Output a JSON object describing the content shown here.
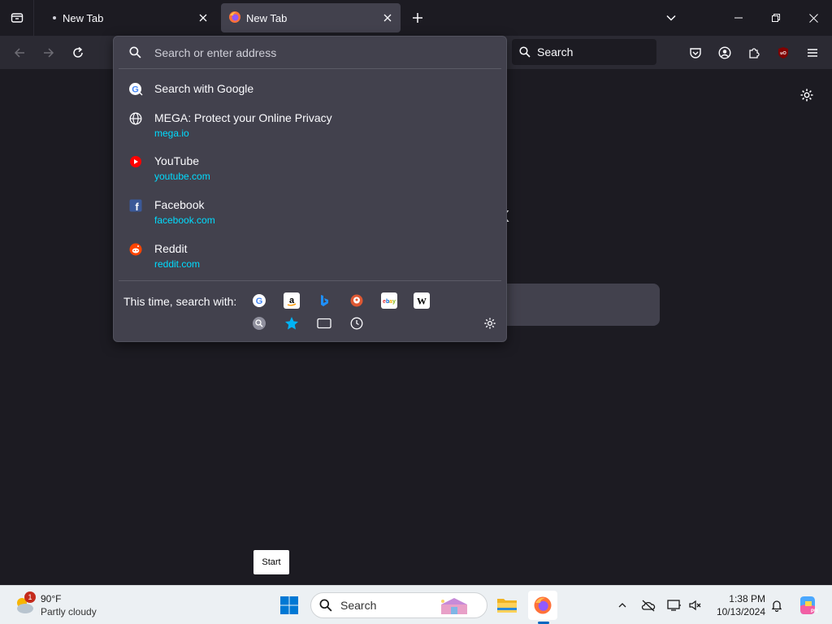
{
  "tabs": [
    {
      "label": "New Tab",
      "active": false
    },
    {
      "label": "New Tab",
      "active": true
    }
  ],
  "toolbar": {
    "search_label": "Search"
  },
  "urlbar": {
    "placeholder": "Search or enter address",
    "results": [
      {
        "title": "Search with Google",
        "url": "",
        "icon": "google-icon"
      },
      {
        "title": "MEGA: Protect your Online Privacy",
        "url": "mega.io",
        "icon": "globe-icon"
      },
      {
        "title": "YouTube",
        "url": "youtube.com",
        "icon": "youtube-icon"
      },
      {
        "title": "Facebook",
        "url": "facebook.com",
        "icon": "facebook-icon"
      },
      {
        "title": "Reddit",
        "url": "reddit.com",
        "icon": "reddit-icon"
      }
    ],
    "oneoff_label": "This time, search with:",
    "engines": [
      "google-icon",
      "amazon-icon",
      "bing-icon",
      "duckduckgo-icon",
      "ebay-icon",
      "wikipedia-icon",
      "search-history-icon",
      "bookmarks-icon",
      "tabs-icon",
      "history-icon"
    ]
  },
  "page": {
    "logo_fragment": "x"
  },
  "tooltip": {
    "text": "Start"
  },
  "taskbar": {
    "weather_temp": "90°F",
    "weather_condition": "Partly cloudy",
    "weather_badge": "1",
    "search_label": "Search",
    "time": "1:38 PM",
    "date": "10/13/2024"
  },
  "colors": {
    "accent_url": "#00ddff",
    "panel_bg": "#42414d",
    "page_bg": "#1c1b22",
    "toolbar_bg": "#2b2a33"
  }
}
